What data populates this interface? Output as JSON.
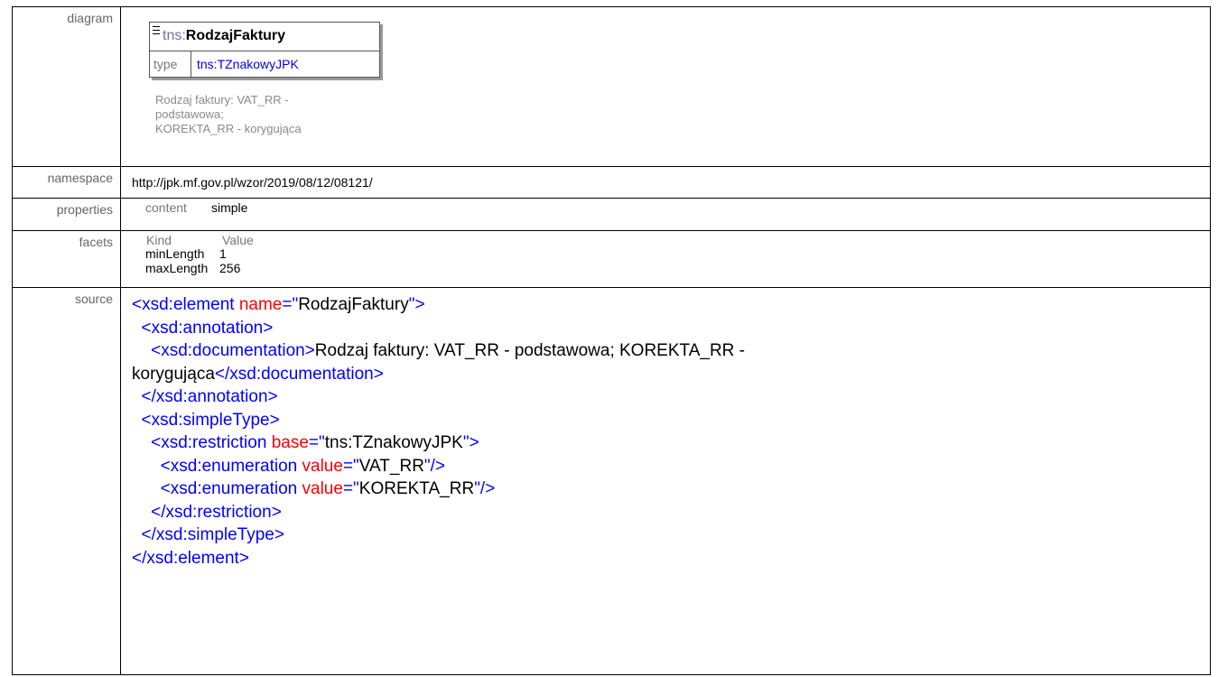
{
  "rows": {
    "diagram": {
      "label": "diagram",
      "element_prefix": "tns:",
      "element_name": "RodzajFaktury",
      "type_label": "type",
      "type_value": "tns:TZnakowyJPK",
      "annotation_lines": [
        "Rodzaj faktury: VAT_RR -",
        "podstawowa;",
        "KOREKTA_RR - korygująca"
      ]
    },
    "namespace": {
      "label": "namespace",
      "value": "http://jpk.mf.gov.pl/wzor/2019/08/12/08121/"
    },
    "properties": {
      "label": "properties",
      "key": "content",
      "value": "simple"
    },
    "facets": {
      "label": "facets",
      "header_kind": "Kind",
      "header_value": "Value",
      "items": [
        {
          "kind": "minLength",
          "value": "1"
        },
        {
          "kind": "maxLength",
          "value": "256"
        }
      ]
    },
    "source": {
      "label": "source",
      "lines": [
        [
          {
            "t": "<xsd:element ",
            "c": "b"
          },
          {
            "t": "name",
            "c": "r"
          },
          {
            "t": "=\"",
            "c": "b"
          },
          {
            "t": "RodzajFaktury",
            "c": "t"
          },
          {
            "t": "\">",
            "c": "b"
          }
        ],
        [
          {
            "t": "  <xsd:annotation>",
            "c": "b"
          }
        ],
        [
          {
            "t": "    <xsd:documentation>",
            "c": "b"
          },
          {
            "t": "Rodzaj faktury: VAT_RR - podstawowa; KOREKTA_RR -",
            "c": "t"
          }
        ],
        [
          {
            "t": "korygująca",
            "c": "t"
          },
          {
            "t": "</xsd:documentation>",
            "c": "b"
          }
        ],
        [
          {
            "t": "  </xsd:annotation>",
            "c": "b"
          }
        ],
        [
          {
            "t": "  <xsd:simpleType>",
            "c": "b"
          }
        ],
        [
          {
            "t": "    <xsd:restriction ",
            "c": "b"
          },
          {
            "t": "base",
            "c": "r"
          },
          {
            "t": "=\"",
            "c": "b"
          },
          {
            "t": "tns:TZnakowyJPK",
            "c": "t"
          },
          {
            "t": "\">",
            "c": "b"
          }
        ],
        [
          {
            "t": "      <xsd:enumeration ",
            "c": "b"
          },
          {
            "t": "value",
            "c": "r"
          },
          {
            "t": "=\"",
            "c": "b"
          },
          {
            "t": "VAT_RR",
            "c": "t"
          },
          {
            "t": "\"/>",
            "c": "b"
          }
        ],
        [
          {
            "t": "      <xsd:enumeration ",
            "c": "b"
          },
          {
            "t": "value",
            "c": "r"
          },
          {
            "t": "=\"",
            "c": "b"
          },
          {
            "t": "KOREKTA_RR",
            "c": "t"
          },
          {
            "t": "\"/>",
            "c": "b"
          }
        ],
        [
          {
            "t": "    </xsd:restriction>",
            "c": "b"
          }
        ],
        [
          {
            "t": "  </xsd:simpleType>",
            "c": "b"
          }
        ],
        [
          {
            "t": "</xsd:element>",
            "c": "b"
          }
        ]
      ]
    }
  }
}
